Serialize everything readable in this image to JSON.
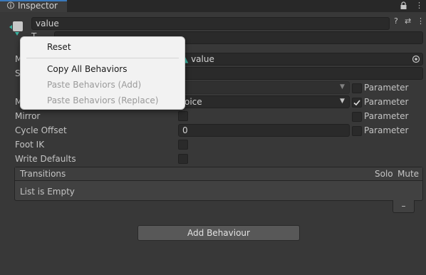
{
  "tab": {
    "title": "Inspector",
    "icon": "info-icon"
  },
  "header": {
    "name_value": "value",
    "icons": [
      "help-icon",
      "preset-icon",
      "kebab-menu-icon"
    ]
  },
  "fields": {
    "motion_value": "value",
    "motion_partial_label": "M",
    "speed_partial_label": "S",
    "mirror_partial_label": "M",
    "choice_partial": "oice",
    "mirror_label": "Mirror",
    "cycle_offset_label": "Cycle Offset",
    "cycle_offset_value": "0",
    "foot_ik_label": "Foot IK",
    "write_defaults_label": "Write Defaults",
    "parameter_label": "Parameter",
    "parameter_checked": [
      false,
      true,
      false,
      false
    ]
  },
  "transitions": {
    "header": "Transitions",
    "solo": "Solo",
    "mute": "Mute",
    "empty_text": "List is Empty",
    "remove_symbol": "–"
  },
  "add_behaviour_label": "Add Behaviour",
  "context_menu": {
    "items": [
      {
        "label": "Reset",
        "enabled": true
      },
      {
        "label": "Copy All Behaviors",
        "enabled": true
      },
      {
        "label": "Paste Behaviors (Add)",
        "enabled": false
      },
      {
        "label": "Paste Behaviors (Replace)",
        "enabled": false
      }
    ]
  },
  "colors": {
    "background": "#383838",
    "accent": "#3a79bb",
    "menu_bg": "#f2f2f2"
  }
}
